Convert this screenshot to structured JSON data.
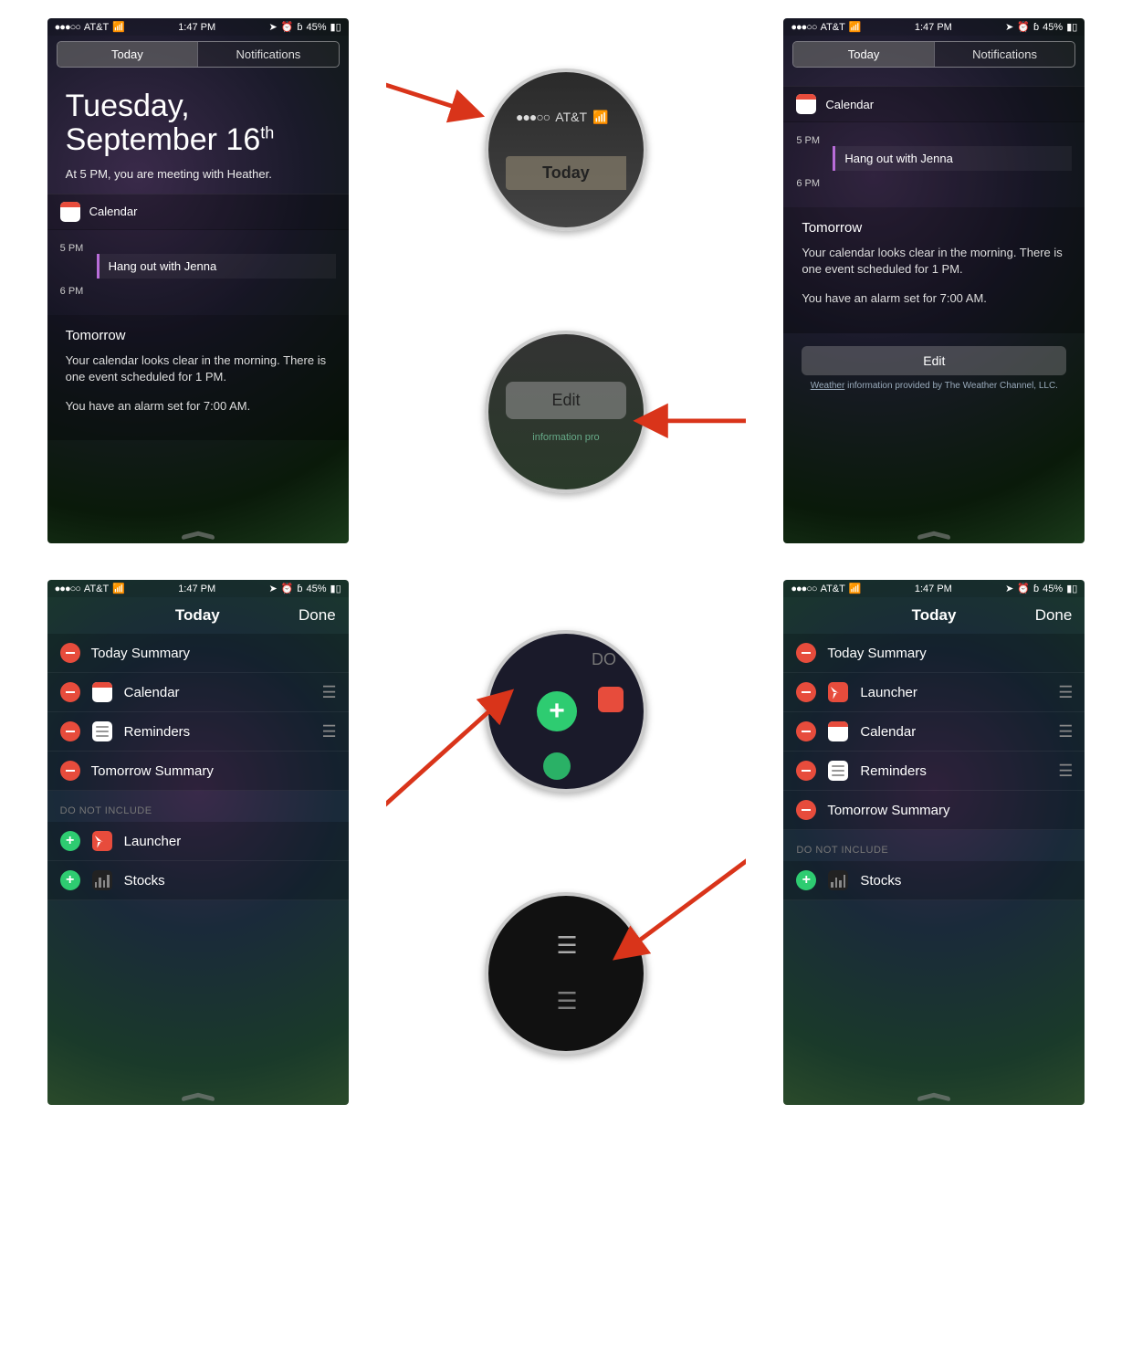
{
  "status": {
    "signal_dots": "●●●○○",
    "carrier": "AT&T",
    "time": "1:47 PM",
    "battery_pct": "45%"
  },
  "tabs": {
    "today": "Today",
    "notifications": "Notifications"
  },
  "today_view": {
    "weekday": "Tuesday,",
    "monthday": "September 16",
    "ordinal": "th",
    "summary": "At 5 PM, you are meeting with Heather.",
    "calendar_label": "Calendar",
    "time_5pm": "5 PM",
    "time_6pm": "6 PM",
    "event": "Hang out with Jenna",
    "tomorrow_title": "Tomorrow",
    "tomorrow_text": "Your calendar looks clear in the morning. There is one event scheduled for 1 PM.",
    "alarm_text": "You have an alarm set for 7:00 AM."
  },
  "edit": {
    "button": "Edit",
    "weather_attr_prefix": "Weather",
    "weather_attr_rest": " information provided by The Weather Channel, LLC."
  },
  "nav": {
    "title": "Today",
    "done": "Done"
  },
  "editlist": {
    "today_summary": "Today Summary",
    "calendar": "Calendar",
    "reminders": "Reminders",
    "tomorrow_summary": "Tomorrow Summary",
    "dni": "DO NOT INCLUDE",
    "launcher": "Launcher",
    "stocks": "Stocks"
  },
  "zoom": {
    "today": "Today",
    "edit": "Edit",
    "edit_info": "information pro",
    "do": "DO"
  }
}
